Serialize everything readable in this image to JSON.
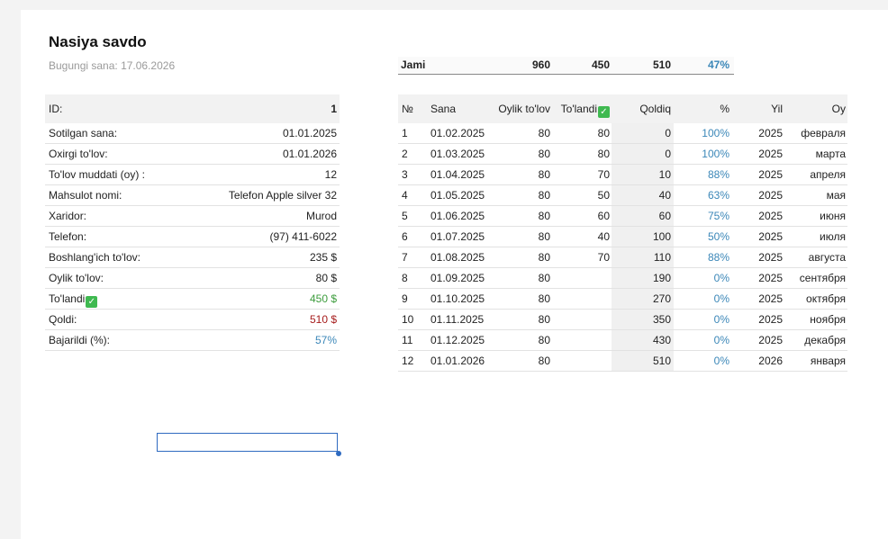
{
  "header": {
    "title": "Nasiya savdo",
    "date_label": "Bugungi sana: 17.06.2026"
  },
  "info": {
    "id_label": "ID:",
    "id_value": "1",
    "rows": [
      {
        "label": "Sotilgan sana:",
        "value": "01.01.2025"
      },
      {
        "label": "Oxirgi to'lov:",
        "value": "01.01.2026"
      },
      {
        "label": "To'lov muddati (oy) :",
        "value": "12"
      },
      {
        "label": "Mahsulot nomi:",
        "value": "Telefon Apple silver 32"
      },
      {
        "label": "Xaridor:",
        "value": "Murod"
      },
      {
        "label": "Telefon:",
        "value": "(97) 411-6022"
      },
      {
        "label": "Boshlang'ich to'lov:",
        "value": "235 $"
      },
      {
        "label": "Oylik to'lov:",
        "value": "80 $"
      },
      {
        "label": "To'landi",
        "value": "450 $"
      },
      {
        "label": "Qoldi:",
        "value": "510 $"
      },
      {
        "label": "Bajarildi (%):",
        "value": "57%"
      }
    ]
  },
  "totals": {
    "label": "Jami",
    "monthly": "960",
    "paid": "450",
    "remaining": "510",
    "percent": "47%"
  },
  "payments": {
    "headers": {
      "no": "№",
      "date": "Sana",
      "monthly": "Oylik to'lov",
      "paid": "To'landi",
      "remaining": "Qoldiq",
      "percent": "%",
      "year": "Yil",
      "month": "Oy"
    },
    "rows": [
      {
        "no": "1",
        "date": "01.02.2025",
        "monthly": "80",
        "paid": "80",
        "remaining": "0",
        "percent": "100%",
        "year": "2025",
        "month": "февраля"
      },
      {
        "no": "2",
        "date": "01.03.2025",
        "monthly": "80",
        "paid": "80",
        "remaining": "0",
        "percent": "100%",
        "year": "2025",
        "month": "марта"
      },
      {
        "no": "3",
        "date": "01.04.2025",
        "monthly": "80",
        "paid": "70",
        "remaining": "10",
        "percent": "88%",
        "year": "2025",
        "month": "апреля"
      },
      {
        "no": "4",
        "date": "01.05.2025",
        "monthly": "80",
        "paid": "50",
        "remaining": "40",
        "percent": "63%",
        "year": "2025",
        "month": "мая"
      },
      {
        "no": "5",
        "date": "01.06.2025",
        "monthly": "80",
        "paid": "60",
        "remaining": "60",
        "percent": "75%",
        "year": "2025",
        "month": "июня"
      },
      {
        "no": "6",
        "date": "01.07.2025",
        "monthly": "80",
        "paid": "40",
        "remaining": "100",
        "percent": "50%",
        "year": "2025",
        "month": "июля"
      },
      {
        "no": "7",
        "date": "01.08.2025",
        "monthly": "80",
        "paid": "70",
        "remaining": "110",
        "percent": "88%",
        "year": "2025",
        "month": "августа"
      },
      {
        "no": "8",
        "date": "01.09.2025",
        "monthly": "80",
        "paid": "",
        "remaining": "190",
        "percent": "0%",
        "year": "2025",
        "month": "сентября"
      },
      {
        "no": "9",
        "date": "01.10.2025",
        "monthly": "80",
        "paid": "",
        "remaining": "270",
        "percent": "0%",
        "year": "2025",
        "month": "октября"
      },
      {
        "no": "10",
        "date": "01.11.2025",
        "monthly": "80",
        "paid": "",
        "remaining": "350",
        "percent": "0%",
        "year": "2025",
        "month": "ноября"
      },
      {
        "no": "11",
        "date": "01.12.2025",
        "monthly": "80",
        "paid": "",
        "remaining": "430",
        "percent": "0%",
        "year": "2025",
        "month": "декабря"
      },
      {
        "no": "12",
        "date": "01.01.2026",
        "monthly": "80",
        "paid": "",
        "remaining": "510",
        "percent": "0%",
        "year": "2026",
        "month": "января"
      }
    ]
  },
  "colors": {
    "accent_blue": "#3b87b8",
    "paid_green": "#3c9c3c",
    "remaining_red": "#a61c1c",
    "check_green": "#3fb950"
  },
  "icons": {
    "paid_check": "check-mark-icon"
  }
}
